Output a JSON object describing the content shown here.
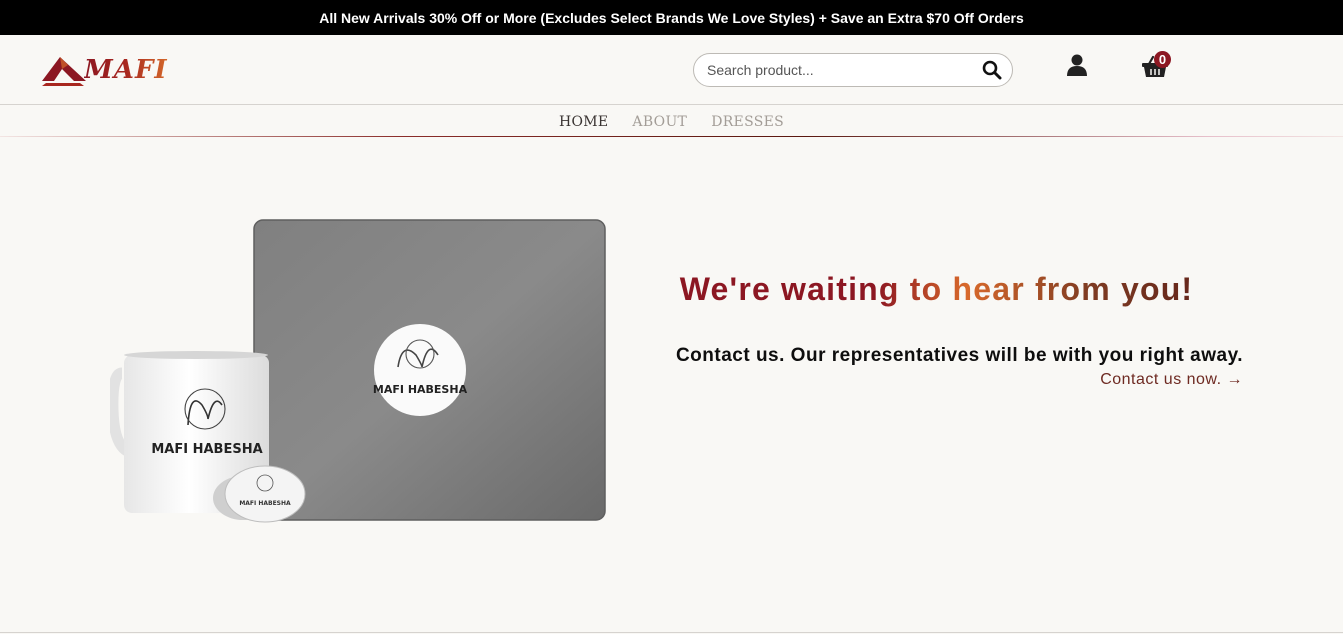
{
  "promo": {
    "text": "All New Arrivals 30% Off or More (Excludes Select Brands We Love Styles) + Save an Extra $70 Off Orders"
  },
  "brand": {
    "logo_text": "MAFI",
    "logo_colors": [
      "#8c1722",
      "#d4682a"
    ]
  },
  "search": {
    "placeholder": "Search product...",
    "value": "",
    "icon": "search-icon"
  },
  "header_icons": {
    "account": "user-icon",
    "cart": "shopping-basket-icon",
    "cart_count": "0"
  },
  "nav": {
    "items": [
      {
        "label": "HOME",
        "active": true
      },
      {
        "label": "ABOUT",
        "active": false
      },
      {
        "label": "DRESSES",
        "active": false
      }
    ]
  },
  "hero": {
    "product_brand": "MAFI HABESHA",
    "headline": "We're waiting to hear from you!",
    "subtext": "Contact us. Our representatives will be with you right away.",
    "cta": "Contact us now. →"
  },
  "colors": {
    "accent": "#8c1722",
    "accent_orange": "#d8692b",
    "link": "#6e2a22",
    "background": "#f9f8f5",
    "promo_bg": "#000000"
  }
}
